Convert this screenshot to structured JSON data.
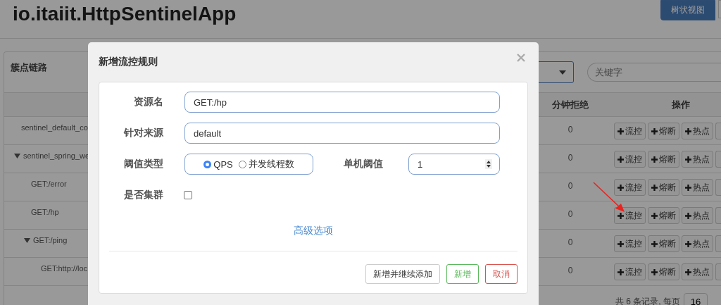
{
  "page": {
    "title": "io.itaiit.HttpSentinelApp",
    "view_buttons": [
      {
        "label": "树状视图",
        "selected": true
      }
    ],
    "panel": {
      "title": "簇点链路",
      "search": {
        "placeholder": "关键字"
      },
      "columns": [
        "分钟拒绝",
        "操作"
      ],
      "rows": [
        {
          "resource": "sentinel_default_co",
          "rejected": "0",
          "actions": [
            "流控",
            "熔断",
            "热点"
          ]
        },
        {
          "resource": "sentinel_spring_we",
          "rejected": "0",
          "actions": [
            "流控",
            "熔断",
            "热点"
          ],
          "expanded": true,
          "children": [
            {
              "resource": "GET:/error",
              "rejected": "0",
              "actions": [
                "流控",
                "熔断",
                "热点"
              ]
            },
            {
              "resource": "GET:/hp",
              "rejected": "0",
              "actions": [
                "流控",
                "熔断",
                "热点"
              ]
            },
            {
              "resource": "GET:/ping",
              "rejected": "0",
              "actions": [
                "流控",
                "熔断",
                "热点"
              ],
              "expanded": true,
              "children": [
                {
                  "resource": "GET:http://loc",
                  "rejected": "0",
                  "actions": [
                    "流控",
                    "熔断",
                    "热点"
                  ]
                }
              ]
            }
          ]
        }
      ],
      "pagination": {
        "summary": "共 6 条记录, 每页",
        "page_size": "16"
      }
    }
  },
  "dialog": {
    "title": "新增流控规则",
    "resource": {
      "label": "资源名",
      "value": "GET:/hp"
    },
    "origin": {
      "label": "针对来源",
      "value": "default"
    },
    "threshold_type": {
      "label": "阈值类型",
      "options": [
        {
          "label": "QPS",
          "selected": true
        },
        {
          "label": "并发线程数",
          "selected": false
        }
      ]
    },
    "threshold": {
      "label": "单机阈值",
      "value": "1"
    },
    "cluster": {
      "label": "是否集群",
      "checked": false
    },
    "advanced_link": "高级选项",
    "buttons": [
      {
        "label": "新增并继续添加",
        "kind": "default"
      },
      {
        "label": "新增",
        "kind": "success"
      },
      {
        "label": "取消",
        "kind": "danger"
      }
    ]
  }
}
